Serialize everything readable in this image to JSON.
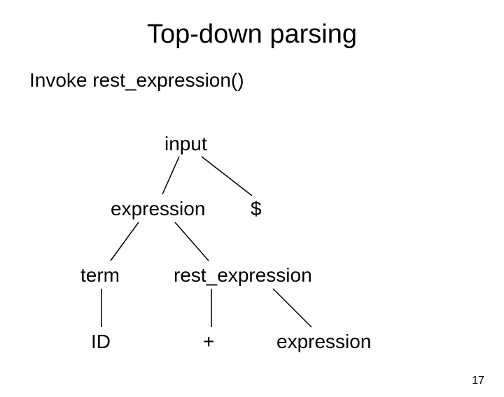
{
  "title": "Top-down parsing",
  "subtitle": "Invoke rest_expression()",
  "nodes": {
    "input": "input",
    "expression": "expression",
    "dollar": "$",
    "term": "term",
    "rest_expression": "rest_expression",
    "id": "ID",
    "plus": "+",
    "expression2": "expression"
  },
  "page_number": "17"
}
